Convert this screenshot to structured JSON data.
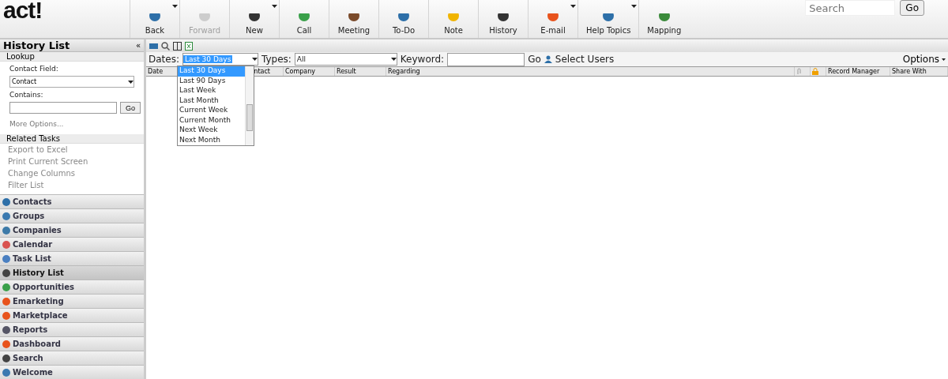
{
  "logo": "act!",
  "toolbar": [
    {
      "label": "Back",
      "disabled": false,
      "dropdown": true
    },
    {
      "label": "Forward",
      "disabled": true,
      "dropdown": false
    },
    {
      "label": "New",
      "disabled": false,
      "dropdown": true
    },
    {
      "label": "Call",
      "disabled": false,
      "dropdown": false
    },
    {
      "label": "Meeting",
      "disabled": false,
      "dropdown": false
    },
    {
      "label": "To-Do",
      "disabled": false,
      "dropdown": false
    },
    {
      "label": "Note",
      "disabled": false,
      "dropdown": false
    },
    {
      "label": "History",
      "disabled": false,
      "dropdown": false
    },
    {
      "label": "E-mail",
      "disabled": false,
      "dropdown": true
    },
    {
      "label": "Help Topics",
      "disabled": false,
      "dropdown": true
    },
    {
      "label": "Mapping",
      "disabled": false,
      "dropdown": false
    }
  ],
  "search": {
    "placeholder": "Search",
    "button": "Go"
  },
  "sidebar": {
    "title": "History List",
    "collapse": "«",
    "lookup": {
      "header": "Lookup",
      "contact_field_label": "Contact Field:",
      "contact_field_value": "Contact",
      "contains_label": "Contains:",
      "go": "Go",
      "more_options": "More Options..."
    },
    "related_tasks": {
      "header": "Related Tasks",
      "items": [
        "Export to Excel",
        "Print Current Screen",
        "Change Columns",
        "Filter List"
      ]
    },
    "nav": [
      {
        "label": "Contacts",
        "selected": false
      },
      {
        "label": "Groups",
        "selected": false
      },
      {
        "label": "Companies",
        "selected": false
      },
      {
        "label": "Calendar",
        "selected": false
      },
      {
        "label": "Task List",
        "selected": false
      },
      {
        "label": "History List",
        "selected": true
      },
      {
        "label": "Opportunities",
        "selected": false
      },
      {
        "label": "Emarketing",
        "selected": false
      },
      {
        "label": "Marketplace",
        "selected": false
      },
      {
        "label": "Reports",
        "selected": false
      },
      {
        "label": "Dashboard",
        "selected": false
      },
      {
        "label": "Search",
        "selected": false
      },
      {
        "label": "Welcome",
        "selected": false
      }
    ]
  },
  "filters": {
    "dates": {
      "label": "Dates:",
      "value": "Last 30 Days",
      "options": [
        {
          "label": "Last 30 Days",
          "selected": true
        },
        {
          "label": "Last 90 Days",
          "selected": false
        },
        {
          "label": "Last Week",
          "selected": false
        },
        {
          "label": "Last Month",
          "selected": false
        },
        {
          "label": "Current Week",
          "selected": false
        },
        {
          "label": "Current Month",
          "selected": false
        },
        {
          "label": "Next Week",
          "selected": false
        },
        {
          "label": "Next Month",
          "selected": false
        }
      ]
    },
    "types": {
      "label": "Types:",
      "value": "All"
    },
    "keyword": {
      "label": "Keyword:",
      "go": "Go"
    },
    "select_users": "Select Users",
    "options": "Options"
  },
  "table": {
    "columns": [
      "Date",
      "ntact",
      "Company",
      "Result",
      "Regarding",
      "Record Manager",
      "Share With"
    ]
  }
}
